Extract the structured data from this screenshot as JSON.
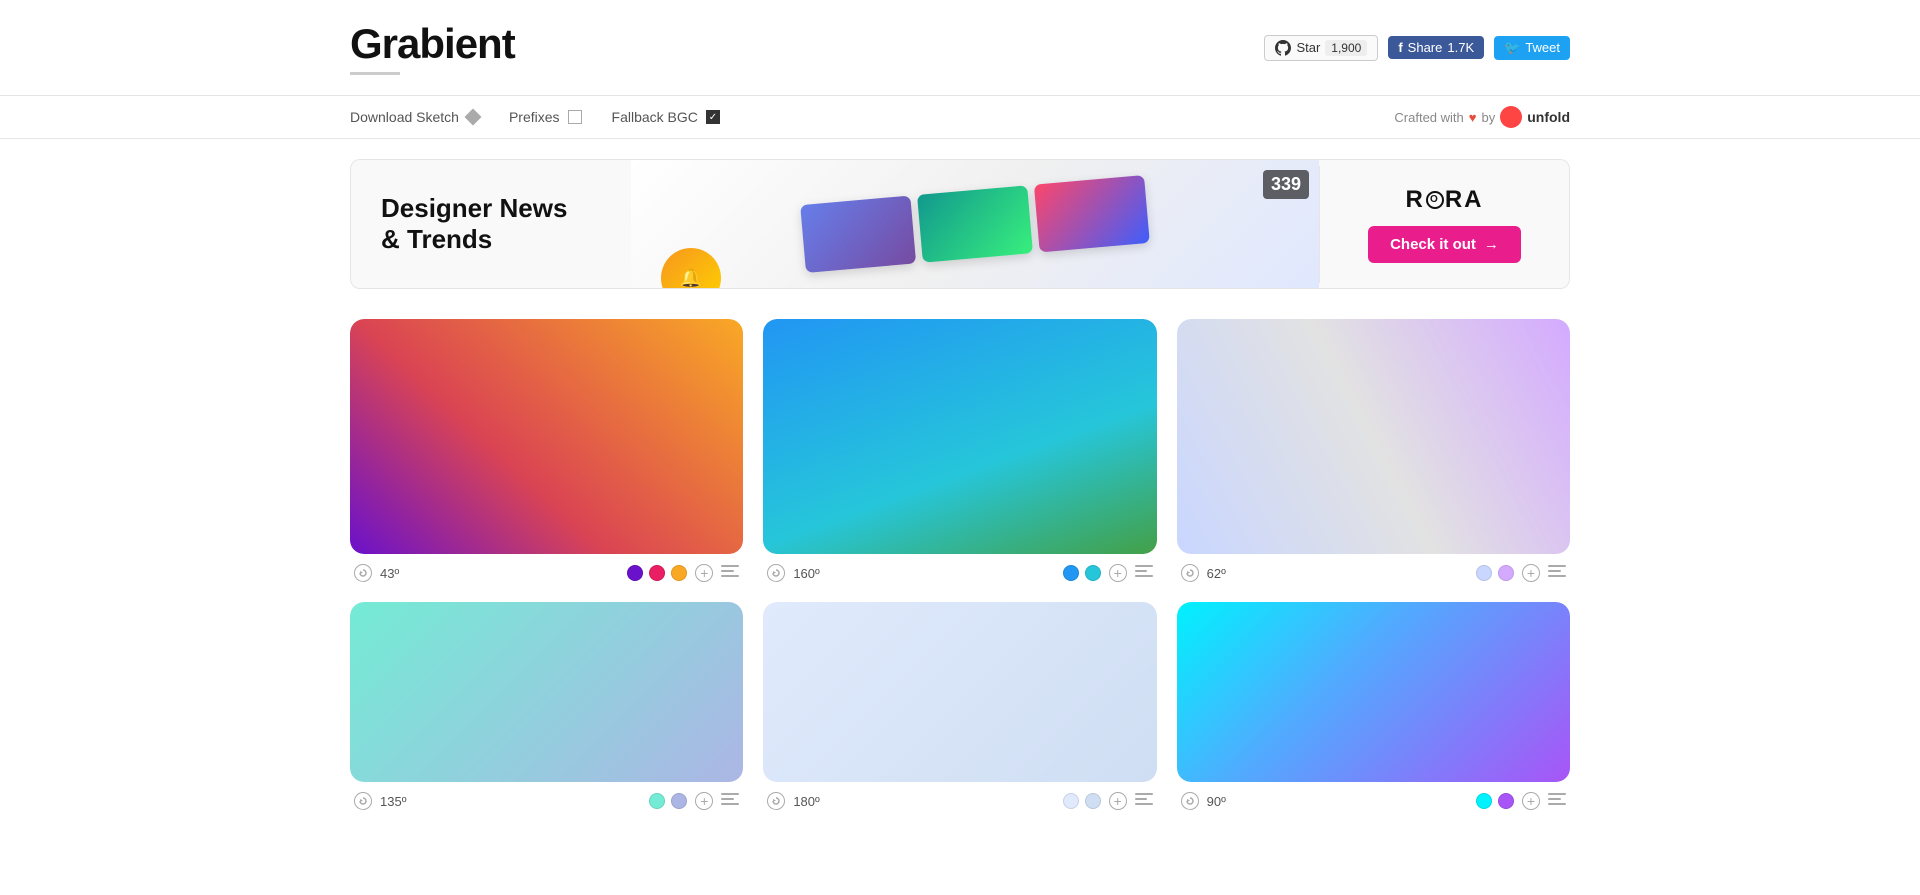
{
  "header": {
    "logo": "Grabient",
    "github": {
      "label": "Star",
      "count": "1,900"
    },
    "facebook": {
      "label": "Share",
      "count": "1.7K"
    },
    "twitter": {
      "label": "Tweet"
    }
  },
  "toolbar": {
    "download_sketch": "Download Sketch",
    "prefixes": "Prefixes",
    "fallback_bgc": "Fallback BGC",
    "crafted_with": "Crafted with",
    "by": "by",
    "unfold": "unfold"
  },
  "banner": {
    "title_line1": "Designer News",
    "title_line2": "& Trends",
    "count": "339",
    "brand": "RORA",
    "cta": "Check it out"
  },
  "gradients": [
    {
      "angle": "43º",
      "colors": [
        "#6a11cb",
        "#e91e63",
        "#f9a825"
      ],
      "class": "g1"
    },
    {
      "angle": "160º",
      "colors": [
        "#2196f3",
        "#26c6da"
      ],
      "class": "g2"
    },
    {
      "angle": "62º",
      "colors": [
        "#c9d6ff",
        "#d4aaff"
      ],
      "class": "g3"
    },
    {
      "angle": "135º",
      "colors": [
        "#74ebd5",
        "#acb6e5"
      ],
      "class": "g4"
    },
    {
      "angle": "180º",
      "colors": [
        "#e0eafc",
        "#cfdef3"
      ],
      "class": "g5"
    },
    {
      "angle": "90º",
      "colors": [
        "#00f2fe",
        "#a855f7"
      ],
      "class": "g6"
    }
  ]
}
